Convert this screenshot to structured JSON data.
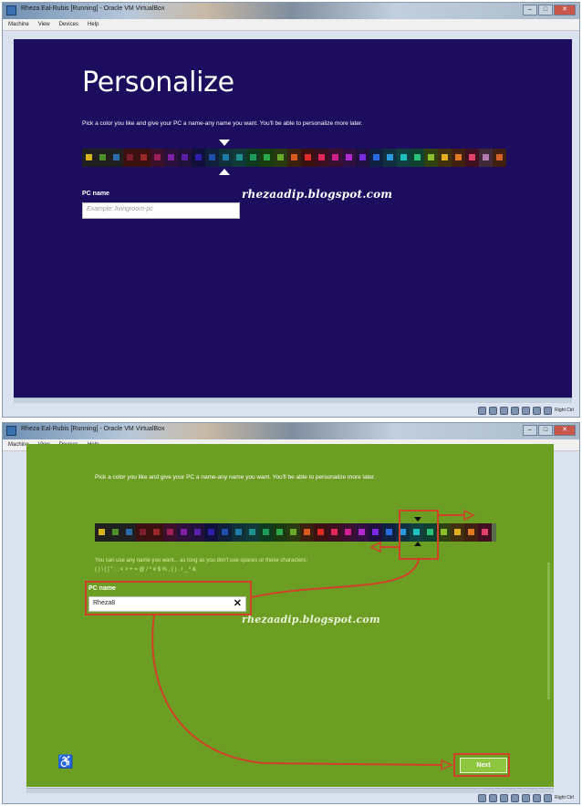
{
  "window1": {
    "title": "Rheza Eal-Rubis [Running] - Oracle VM VirtualBox",
    "menu": [
      "Machine",
      "View",
      "Devices",
      "Help"
    ],
    "page": {
      "heading": "Personalize",
      "intro": "Pick a color you like and give your PC a name-any name you want. You'll be able to personalize more later.",
      "pc_name_label": "PC name",
      "pc_name_placeholder": "Example: livingroom-pc"
    },
    "watermark": "rhezaadip.blogspot.com",
    "status_hostkey": "Right Ctrl",
    "background_color": "#1c0d5e"
  },
  "window2": {
    "title": "Rheza Eal-Rubis [Running] - Oracle VM VirtualBox",
    "menu": [
      "Machine",
      "View",
      "Devices",
      "Help"
    ],
    "page": {
      "intro": "Pick a color you like and give your PC a name-any name you want. You'll be able to personalize more later.",
      "hint_line1": "You can use any name you want... as long as you don't use spaces or these characters:",
      "hint_line2": "( ) \\ [ ] \" ; : < > + = @ / * # $ % , ( ) . / _ * &",
      "pc_name_label": "PC name",
      "pc_name_value": "Rheza8",
      "clear_icon": "✕",
      "next_label": "Next"
    },
    "watermark": "rhezaadip.blogspot.com",
    "status_hostkey": "Right Ctrl",
    "background_color": "#6b9e22"
  },
  "palette1": [
    "#1c0d5e",
    "#1c0d5e",
    "#1c0d5e",
    "#1c0d5e",
    "#1c0d5e",
    "#1c0d5e",
    "#1c0d5e",
    "#1c0d5e",
    "#1c0d5e",
    "#1c0d5e",
    "#1c0d5e",
    "#1c0d5e",
    "#1c0d5e",
    "#1c0d5e",
    "#1c0d5e",
    "#1c0d5e",
    "#1c0d5e",
    "#1c0d5e",
    "#1c0d5e",
    "#1c0d5e",
    "#1c0d5e",
    "#1c0d5e",
    "#1c0d5e",
    "#1c0d5e",
    "#1c0d5e",
    "#1c0d5e",
    "#1c0d5e",
    "#1c0d5e",
    "#1c0d5e",
    "#1c0d5e",
    "#1c0d5e"
  ],
  "palette_tiles": [
    "#d8b320",
    "#4d8f2a",
    "#2c6aa8",
    "#7a1f2c",
    "#9a2a2a",
    "#9c1f5a",
    "#7d1fa0",
    "#5b1fa8",
    "#2e1fa8",
    "#1f4fa8",
    "#1f7aa8",
    "#1f8f8f",
    "#1f9a5a",
    "#2aa84a",
    "#6aa82a",
    "#d85a1f",
    "#e02a2a",
    "#e0285a",
    "#d0208f",
    "#b02ad0",
    "#7a2ae0",
    "#2a6ae0",
    "#2a9ae0",
    "#1fc0c0",
    "#2ac07a",
    "#8ac02a",
    "#e0b020",
    "#e07a20",
    "#e0406a",
    "#b07ab0",
    "#d8602a"
  ],
  "palette_bg": [
    "#202020",
    "#202020",
    "#202020",
    "#3a1010",
    "#3a1010",
    "#3a102a",
    "#2a103a",
    "#20103a",
    "#10103a",
    "#10203a",
    "#10303a",
    "#103a3a",
    "#103a20",
    "#1a3a10",
    "#2a3a10",
    "#3a2010",
    "#3a1010",
    "#3a1020",
    "#3a1030",
    "#301040",
    "#201040",
    "#102040",
    "#103040",
    "#104040",
    "#104030",
    "#304010",
    "#403010",
    "#402010",
    "#401020",
    "#402a3a",
    "#402010"
  ],
  "selected_index_1": 8,
  "selected_index_2": 25
}
